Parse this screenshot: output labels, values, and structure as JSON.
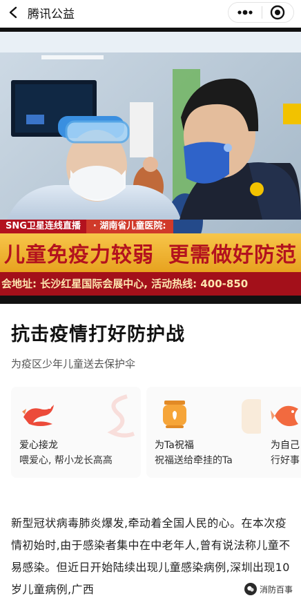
{
  "nav": {
    "title": "腾讯公益",
    "back_icon": "chevron-left-icon",
    "more_icon": "more-dots-icon",
    "close_icon": "target-close-icon"
  },
  "hero": {
    "tag_live": "SNG卫星连线直播",
    "tag_hospital": "· 湖南省儿童医院:",
    "headline_left": "儿童免疫力较弱",
    "headline_right": "更需做好防范",
    "footer": "会地址: 长沙红星国际会展中心, 活动热线: 400-850"
  },
  "article": {
    "title": "抗击疫情打好防护战",
    "subtitle": "为疫区少年儿童送去保护伞"
  },
  "cards": [
    {
      "title": "爱心接龙",
      "desc": "喂爱心, 帮小龙长高高",
      "icon": "dragon-icon"
    },
    {
      "title": "为Ta祝福",
      "desc": "祝福送给牵挂的Ta",
      "icon": "lantern-icon"
    },
    {
      "title": "为自己",
      "desc": "行好事",
      "icon": "koi-fish-icon"
    }
  ],
  "body": {
    "paragraph": "新型冠状病毒肺炎爆发,牵动着全国人民的心。在本次疫情初始时,由于感染者集中在中老年人,曾有说法称儿童不易感染。但近日开始陆续出现儿童感染病例,深圳出现10岁儿童病例,广西"
  },
  "watermark": {
    "text": "消防百事",
    "icon": "wechat-account-icon"
  },
  "colors": {
    "ticker_red": "#b3121e",
    "ticker_gold": "#f7c64a",
    "card_bg": "#fafafa"
  }
}
